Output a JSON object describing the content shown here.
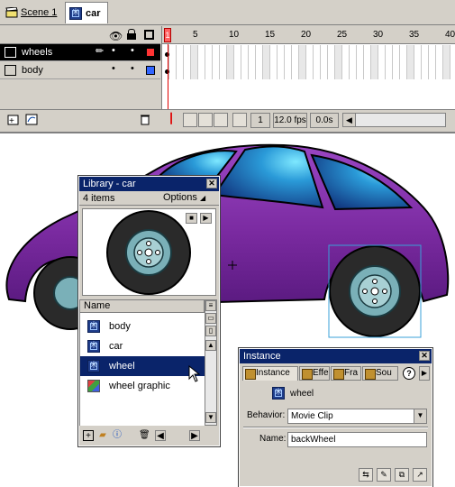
{
  "scene_bar": {
    "scene_label": "Scene 1",
    "symbol_label": "car"
  },
  "timeline": {
    "frame_numbers": [
      "1",
      "5",
      "10",
      "15",
      "20",
      "25",
      "30",
      "35",
      "40"
    ],
    "layers": [
      {
        "name": "wheels",
        "selected": true,
        "color": "#ff3333"
      },
      {
        "name": "body",
        "selected": false,
        "color": "#3366ff"
      }
    ],
    "current_frame": "1",
    "fps": "12.0 fps",
    "time": "0.0s"
  },
  "library": {
    "title": "Library - car",
    "count": "4 items",
    "options_label": "Options",
    "name_header": "Name",
    "items": [
      {
        "name": "body",
        "icon": "movieclip-icon",
        "selected": false
      },
      {
        "name": "car",
        "icon": "movieclip-icon",
        "selected": false
      },
      {
        "name": "wheel",
        "icon": "movieclip-icon",
        "selected": true
      },
      {
        "name": "wheel graphic",
        "icon": "graphic-icon",
        "selected": false
      }
    ]
  },
  "instance_panel": {
    "title": "Instance",
    "tabs": [
      "Instance",
      "Effe",
      "Fra",
      "Sou"
    ],
    "symbol_name": "wheel",
    "behavior_label": "Behavior:",
    "behavior_value": "Movie Clip",
    "name_label": "Name:",
    "name_value": "backWheel"
  },
  "colors": {
    "car_body": "#7a2aa0",
    "window": "#1a3aa0",
    "selection": "#0a246a",
    "tire": "#2a2a2a",
    "hub": "#7ab0b8"
  }
}
